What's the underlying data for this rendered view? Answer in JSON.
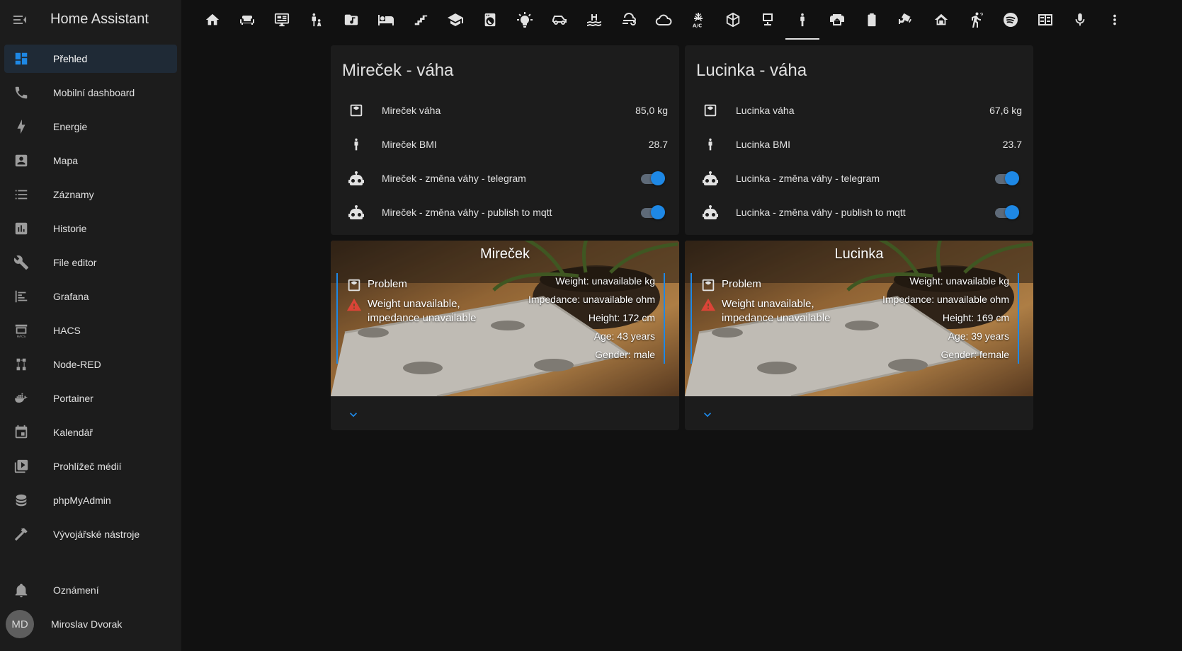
{
  "app": {
    "title": "Home Assistant"
  },
  "sidebar": {
    "items": [
      {
        "label": "Přehled",
        "icon": "dashboard-icon"
      },
      {
        "label": "Mobilní dashboard",
        "icon": "phone-icon"
      },
      {
        "label": "Energie",
        "icon": "lightning-icon"
      },
      {
        "label": "Mapa",
        "icon": "account-box-icon"
      },
      {
        "label": "Záznamy",
        "icon": "list-icon"
      },
      {
        "label": "Historie",
        "icon": "chart-box-icon"
      },
      {
        "label": "File editor",
        "icon": "wrench-icon"
      },
      {
        "label": "Grafana",
        "icon": "chart-timeline-icon"
      },
      {
        "label": "HACS",
        "icon": "hacs-icon"
      },
      {
        "label": "Node-RED",
        "icon": "sitemap-icon"
      },
      {
        "label": "Portainer",
        "icon": "docker-icon"
      },
      {
        "label": "Kalendář",
        "icon": "calendar-icon"
      },
      {
        "label": "Prohlížeč médií",
        "icon": "play-box-icon"
      },
      {
        "label": "phpMyAdmin",
        "icon": "database-icon"
      },
      {
        "label": "Vývojářské nástroje",
        "icon": "hammer-icon"
      }
    ],
    "notifications": {
      "label": "Oznámení",
      "icon": "bell-icon"
    },
    "user": {
      "initials": "MD",
      "name": "Miroslav Dvorak"
    }
  },
  "topbar": {
    "tabs": [
      "home-icon",
      "sofa-icon",
      "monitor-icon",
      "family-icon",
      "folder-music-icon",
      "bed-icon",
      "stairs-icon",
      "school-icon",
      "washing-machine-icon",
      "lightbulb-icon",
      "car-icon",
      "pool-icon",
      "weather-windy-icon",
      "cloud-icon",
      "air-conditioner-icon",
      "cube-icon",
      "desk-icon",
      "human-icon",
      "printer-3d-icon",
      "battery-icon",
      "cctv-icon",
      "home-roof-icon",
      "run-icon",
      "spotify-icon",
      "server-network-icon",
      "microphone-icon",
      "more-vertical-icon"
    ],
    "active_tab": 17
  },
  "cards": [
    {
      "title": "Mireček - váha",
      "weight_label": "Mireček váha",
      "weight_value": "85,0 kg",
      "bmi_label": "Mireček BMI",
      "bmi_value": "28.7",
      "telegram_label": "Mireček - změna váhy - telegram",
      "mqtt_label": "Mireček - změna váhy - publish to mqtt"
    },
    {
      "title": "Lucinka - váha",
      "weight_label": "Lucinka váha",
      "weight_value": "67,6 kg",
      "bmi_label": "Lucinka BMI",
      "bmi_value": "23.7",
      "telegram_label": "Lucinka - změna váhy - telegram",
      "mqtt_label": "Lucinka - změna váhy - publish to mqtt"
    }
  ],
  "scales": [
    {
      "name": "Mireček",
      "problem": "Problem",
      "warning": "Weight unavailable, impedance unavailable",
      "weight": "Weight: unavailable kg",
      "impedance": "Impedance: unavailable ohm",
      "height": "Height: 172 cm",
      "age": "Age: 43 years",
      "gender": "Gender: male"
    },
    {
      "name": "Lucinka",
      "problem": "Problem",
      "warning": "Weight unavailable, impedance unavailable",
      "weight": "Weight: unavailable kg",
      "impedance": "Impedance: unavailable ohm",
      "height": "Height: 169 cm",
      "age": "Age: 39 years",
      "gender": "Gender: female"
    }
  ],
  "colors": {
    "accent": "#1e88e5",
    "warning": "#db4437",
    "background": "#111111",
    "card": "#1c1c1c"
  }
}
